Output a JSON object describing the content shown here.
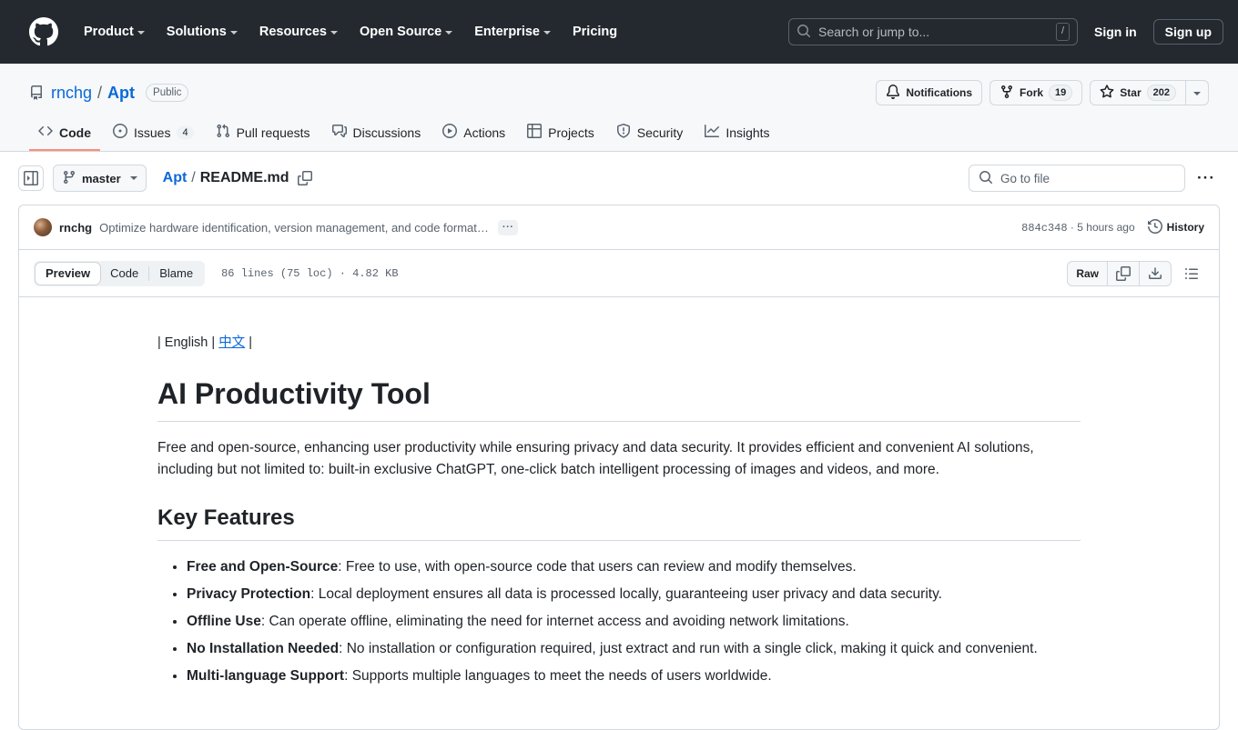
{
  "global_header": {
    "logo_icon": "github-mark-icon",
    "nav": [
      {
        "label": "Product",
        "has_caret": true
      },
      {
        "label": "Solutions",
        "has_caret": true
      },
      {
        "label": "Resources",
        "has_caret": true
      },
      {
        "label": "Open Source",
        "has_caret": true
      },
      {
        "label": "Enterprise",
        "has_caret": true
      },
      {
        "label": "Pricing",
        "has_caret": false
      }
    ],
    "search": {
      "placeholder": "Search or jump to...",
      "shortcut_key": "/",
      "icon": "search-icon"
    },
    "sign_in": "Sign in",
    "sign_up": "Sign up",
    "background_color": "#24292f"
  },
  "repo": {
    "icon": "repo-book-icon",
    "owner": "rnchg",
    "separator": "/",
    "name": "Apt",
    "visibility": "Public",
    "actions": {
      "notifications": {
        "label": "Notifications",
        "icon": "bell-icon"
      },
      "fork": {
        "label": "Fork",
        "count": "19",
        "icon": "fork-icon"
      },
      "star": {
        "label": "Star",
        "count": "202",
        "icon": "star-icon"
      },
      "star_dropdown_icon": "triangle-down-icon"
    },
    "tabs": [
      {
        "label": "Code",
        "icon": "code-icon",
        "count": null,
        "active": true
      },
      {
        "label": "Issues",
        "icon": "issue-opened-icon",
        "count": "4",
        "active": false
      },
      {
        "label": "Pull requests",
        "icon": "git-pull-request-icon",
        "count": null,
        "active": false
      },
      {
        "label": "Discussions",
        "icon": "comment-discussion-icon",
        "count": null,
        "active": false
      },
      {
        "label": "Actions",
        "icon": "play-icon",
        "count": null,
        "active": false
      },
      {
        "label": "Projects",
        "icon": "table-icon",
        "count": null,
        "active": false
      },
      {
        "label": "Security",
        "icon": "shield-icon",
        "count": null,
        "active": false
      },
      {
        "label": "Insights",
        "icon": "graph-icon",
        "count": null,
        "active": false
      }
    ],
    "active_tab_underline_color": "#fd8c73"
  },
  "file_nav": {
    "sidebar_toggle_icon": "sidebar-expand-icon",
    "branch": {
      "name": "master",
      "icon": "git-branch-icon"
    },
    "breadcrumb": {
      "dir": "Apt",
      "separator": "/",
      "file": "README.md",
      "copy_icon": "copy-icon"
    },
    "go_to_file": {
      "placeholder": "Go to file",
      "icon": "search-icon"
    },
    "more_menu_label": "···"
  },
  "commit": {
    "avatar": "user-avatar",
    "author": "rnchg",
    "message": "Optimize hardware identification, version management, and code format…",
    "expand_label": "···",
    "sha": "884c348",
    "separator": "·",
    "relative_time": "5 hours ago",
    "history": {
      "label": "History",
      "icon": "history-icon"
    }
  },
  "file_view": {
    "views": [
      {
        "label": "Preview",
        "active": true
      },
      {
        "label": "Code",
        "active": false
      },
      {
        "label": "Blame",
        "active": false
      }
    ],
    "meta": "86 lines (75 loc) · 4.82 KB",
    "raw_label": "Raw",
    "copy_icon": "copy-raw-icon",
    "download_icon": "download-icon",
    "outline_icon": "list-unordered-icon"
  },
  "readme": {
    "lang_prefix": "| English | ",
    "lang_link": "中文",
    "lang_suffix": " |",
    "title": "AI Productivity Tool",
    "intro": "Free and open-source, enhancing user productivity while ensuring privacy and data security. It provides efficient and convenient AI solutions, including but not limited to: built-in exclusive ChatGPT, one-click batch intelligent processing of images and videos, and more.",
    "features_heading": "Key Features",
    "features": [
      {
        "term": "Free and Open-Source",
        "desc": ": Free to use, with open-source code that users can review and modify themselves."
      },
      {
        "term": "Privacy Protection",
        "desc": ": Local deployment ensures all data is processed locally, guaranteeing user privacy and data security."
      },
      {
        "term": "Offline Use",
        "desc": ": Can operate offline, eliminating the need for internet access and avoiding network limitations."
      },
      {
        "term": "No Installation Needed",
        "desc": ": No installation or configuration required, just extract and run with a single click, making it quick and convenient."
      },
      {
        "term": "Multi-language Support",
        "desc": ": Supports multiple languages to meet the needs of users worldwide."
      }
    ]
  },
  "colors": {
    "link": "#0969da",
    "header_bg": "#24292f",
    "band_bg": "#f6f8fa",
    "border": "#d1d9e0",
    "muted_text": "#59636e"
  }
}
